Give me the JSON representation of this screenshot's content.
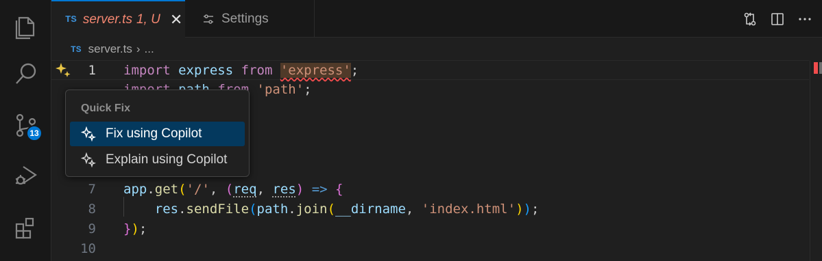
{
  "activity_bar": {
    "items": [
      {
        "name": "explorer",
        "icon": "files-icon"
      },
      {
        "name": "search",
        "icon": "search-icon"
      },
      {
        "name": "source-control",
        "icon": "source-control-icon",
        "badge": "13"
      },
      {
        "name": "run-debug",
        "icon": "run-debug-icon"
      },
      {
        "name": "extensions",
        "icon": "extensions-icon"
      }
    ]
  },
  "tabs": [
    {
      "lang": "TS",
      "label": "server.ts",
      "status": "1, U",
      "active": true
    },
    {
      "label": "Settings",
      "active": false
    }
  ],
  "breadcrumb": {
    "lang": "TS",
    "file": "server.ts",
    "sep": "›",
    "more": "..."
  },
  "editor": {
    "lines": [
      {
        "num": "1"
      },
      {
        "num": "7"
      },
      {
        "num": "8"
      },
      {
        "num": "9"
      },
      {
        "num": "10"
      }
    ]
  },
  "quick_fix": {
    "title": "Quick Fix",
    "items": [
      {
        "label": "Fix using Copilot",
        "selected": true
      },
      {
        "label": "Explain using Copilot",
        "selected": false
      }
    ]
  },
  "colors": {
    "accent": "#0078d4",
    "error": "#f14c4c",
    "selection": "#04395e"
  }
}
